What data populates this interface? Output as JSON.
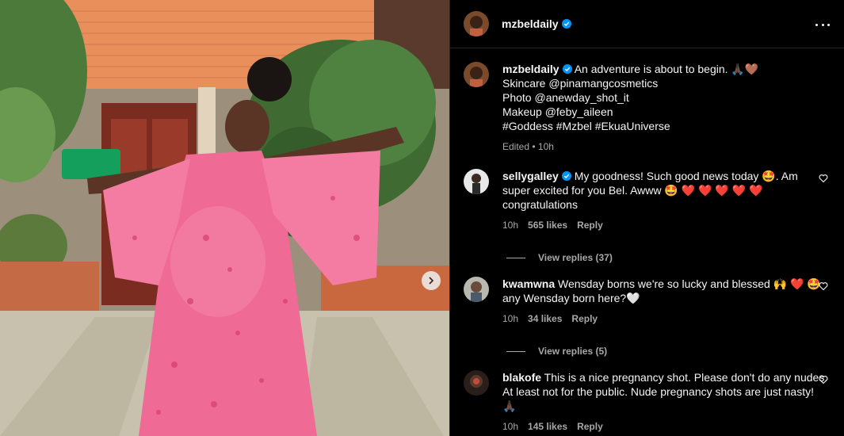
{
  "post": {
    "author": "mzbeldaily",
    "caption_main": "An adventure is about to begin. 🙏🏿🤎",
    "caption_lines": [
      "Skincare @pinamangcosmetics",
      "Photo @anewday_shot_it",
      "Makeup @feby_aileen",
      "#Goddess #Mzbel #EkuaUniverse"
    ],
    "edited": "Edited • 10h"
  },
  "comments": [
    {
      "user": "sellygalley",
      "verified": true,
      "text_parts": [
        "My goodness! Such good news today 🤩. Am super excited for you Bel. Awww 🤩 ❤️ ❤️ ❤️ ❤️ ❤️ congratulations"
      ],
      "time": "10h",
      "likes": "565 likes",
      "reply": "Reply",
      "view_replies": "View replies (37)"
    },
    {
      "user": "kwamwna",
      "verified": false,
      "text_parts": [
        "Wensday borns we're so lucky and blessed 🙌 ❤️ 🤩 any Wensday born here?🤍"
      ],
      "time": "10h",
      "likes": "34 likes",
      "reply": "Reply",
      "view_replies": "View replies (5)"
    },
    {
      "user": "blakofe",
      "verified": false,
      "text_parts": [
        "This is a nice pregnancy shot. Please don't do any nudes. At least not for the public. Nude pregnancy shots are just nasty! 🙏🏿"
      ],
      "time": "10h",
      "likes": "145 likes",
      "reply": "Reply",
      "view_replies": ""
    }
  ],
  "colors": {
    "verified": "#0095f6",
    "muted": "#a8a8a8",
    "dress": "#f06a96"
  },
  "icons": {
    "more": "more-options-icon",
    "like": "heart-outline-icon",
    "next": "chevron-right-icon"
  }
}
